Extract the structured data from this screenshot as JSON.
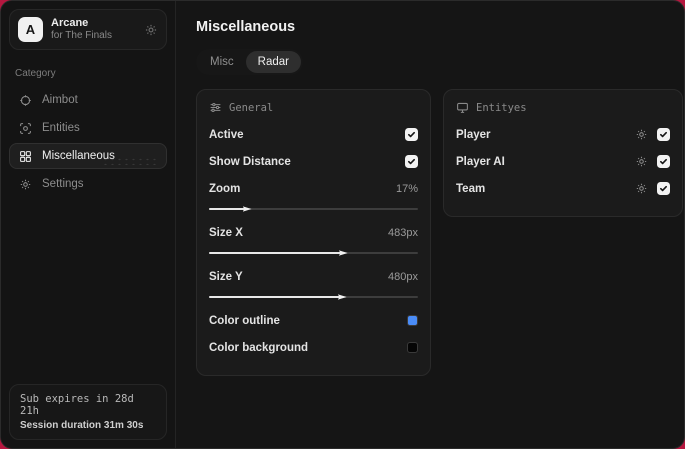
{
  "colors": {
    "backdrop": "#b5173f",
    "accent_blue": "#4a8cf7",
    "swatch_black": "#050505"
  },
  "sidebar": {
    "header": {
      "avatar_letter": "A",
      "title": "Arcane",
      "subtitle": "for The Finals"
    },
    "category_label": "Category",
    "items": [
      {
        "label": "Aimbot",
        "selected": false
      },
      {
        "label": "Entities",
        "selected": false
      },
      {
        "label": "Miscellaneous",
        "selected": true
      },
      {
        "label": "Settings",
        "selected": false
      }
    ],
    "footer": {
      "line1": "Sub expires in 28d 21h",
      "line2": "Session duration 31m 30s"
    }
  },
  "main": {
    "title": "Miscellaneous",
    "tabs": [
      {
        "label": "Misc",
        "active": false
      },
      {
        "label": "Radar",
        "active": true
      }
    ],
    "general": {
      "header": "General",
      "toggles": [
        {
          "label": "Active",
          "checked": true
        },
        {
          "label": "Show Distance",
          "checked": true
        }
      ],
      "sliders": [
        {
          "label": "Zoom",
          "value": "17%",
          "fill": "17%"
        },
        {
          "label": "Size X",
          "value": "483px",
          "fill": "63%"
        },
        {
          "label": "Size Y",
          "value": "480px",
          "fill": "62.5%"
        }
      ],
      "color_rows": [
        {
          "label": "Color outline",
          "color": "#4a8cf7"
        },
        {
          "label": "Color background",
          "color": "#050505"
        }
      ]
    },
    "entities": {
      "header": "Entityes",
      "rows": [
        {
          "label": "Player",
          "checked": true
        },
        {
          "label": "Player AI",
          "checked": true
        },
        {
          "label": "Team",
          "checked": true
        }
      ]
    }
  }
}
